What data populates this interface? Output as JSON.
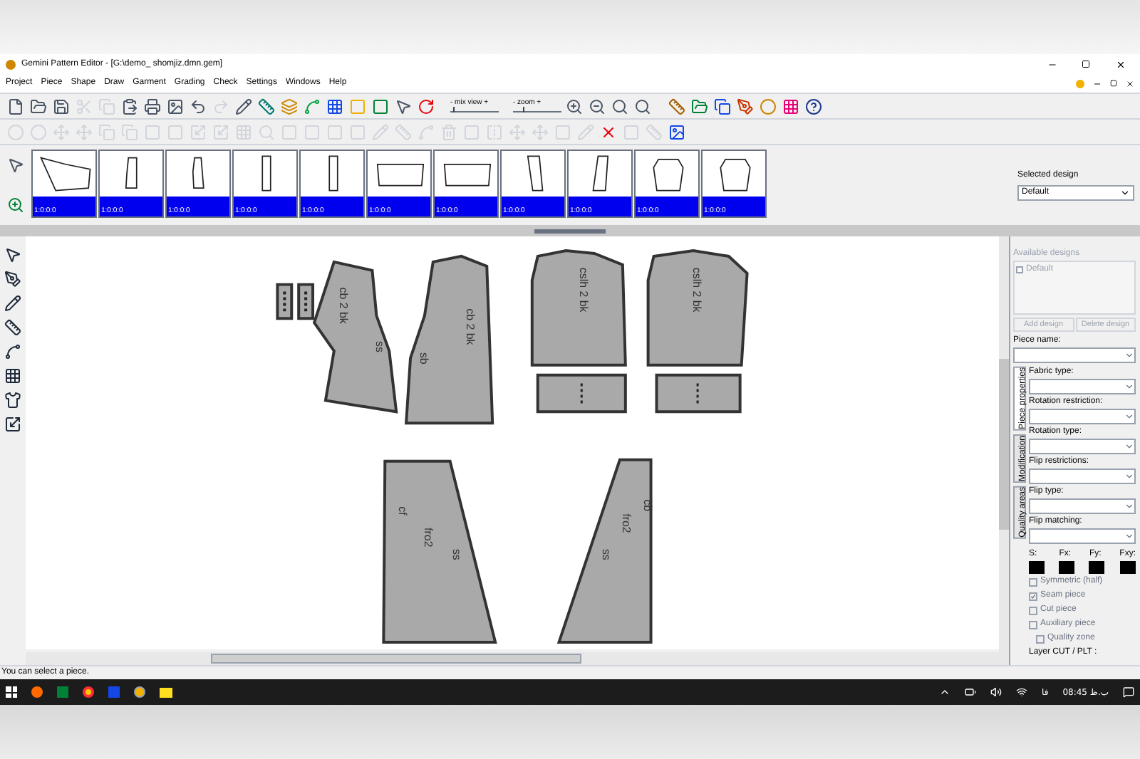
{
  "window": {
    "title": "Gemini Pattern Editor - [G:\\demo_ shomjiz.dmn.gem]"
  },
  "menu": [
    "Project",
    "Piece",
    "Shape",
    "Draw",
    "Garment",
    "Grading",
    "Check",
    "Settings",
    "Windows",
    "Help"
  ],
  "toolbar": {
    "mix_view": {
      "label": "- mix view +",
      "level": 0.05
    },
    "zoom": {
      "label": "- zoom +",
      "level": 0.2
    }
  },
  "thumbnails": [
    {
      "label": "1:0:0:0",
      "selected": true
    },
    {
      "label": "1:0:0:0",
      "selected": true
    },
    {
      "label": "1:0:0:0",
      "selected": true
    },
    {
      "label": "1:0:0:0",
      "selected": true
    },
    {
      "label": "1:0:0:0",
      "selected": true
    },
    {
      "label": "1:0:0:0",
      "selected": true
    },
    {
      "label": "1:0:0:0",
      "selected": true
    },
    {
      "label": "1:0:0:0",
      "selected": true
    },
    {
      "label": "1:0:0:0",
      "selected": true
    },
    {
      "label": "1:0:0:0",
      "selected": true
    },
    {
      "label": "1:0:0:0",
      "selected": true
    }
  ],
  "selected_design": {
    "label": "Selected design",
    "value": "Default"
  },
  "pieces": [
    {
      "kind": "tab"
    },
    {
      "kind": "tab"
    },
    {
      "kind": "panel",
      "labels": [
        "cb 2 bk",
        "ss"
      ]
    },
    {
      "kind": "panel",
      "labels": [
        "cb 2 bk",
        "sb"
      ]
    },
    {
      "kind": "panel",
      "labels": [
        "cslh 2 bk"
      ]
    },
    {
      "kind": "panel",
      "labels": [
        "cslh 2 bk"
      ]
    },
    {
      "kind": "band"
    },
    {
      "kind": "band"
    },
    {
      "kind": "panel",
      "labels": [
        "cf",
        "fro2",
        "ss"
      ]
    },
    {
      "kind": "panel",
      "labels": [
        "ss",
        "fro2",
        "cb"
      ]
    }
  ],
  "panel": {
    "available_designs": "Available designs",
    "designs": [
      {
        "label": "Default",
        "checked": false
      }
    ],
    "add_button": "Add design",
    "delete_button": "Delete design",
    "piece_name": "Piece name:",
    "tabs": [
      {
        "label": "Piece properties",
        "selected": true
      },
      {
        "label": "Modification",
        "selected": false
      },
      {
        "label": "Quality areas",
        "selected": false
      }
    ],
    "fields": [
      "Fabric type:",
      "Rotation restriction:",
      "Rotation type:",
      "Flip restrictions:",
      "Flip type:",
      "Flip matching:"
    ],
    "swatches": [
      "S:",
      "Fx:",
      "Fy:",
      "Fxy:"
    ],
    "options": [
      {
        "label": "Symmetric (half)",
        "checked": false,
        "indented": false
      },
      {
        "label": "Seam piece",
        "checked": true,
        "indented": false
      },
      {
        "label": "Cut piece",
        "checked": false,
        "indented": false
      },
      {
        "label": "Auxiliary piece",
        "checked": false,
        "indented": false
      },
      {
        "label": "Quality zone",
        "checked": false,
        "indented": true
      }
    ],
    "layer": "Layer CUT / PLT :"
  },
  "status_bar": "You can select a piece.",
  "taskbar": {
    "language": "فا",
    "time": "08:45 ب.ظ"
  }
}
